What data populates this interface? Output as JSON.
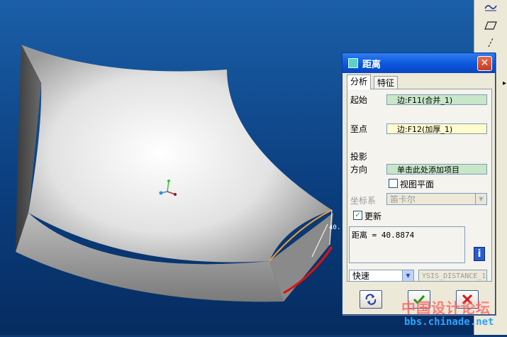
{
  "dialog": {
    "title": "距离",
    "close_symbol": "✕",
    "tabs": [
      {
        "label": "分析"
      },
      {
        "label": "特征"
      }
    ],
    "from_label": "起始",
    "from_value": "边:F11(合并_1)",
    "to_label": "至点",
    "to_value": "边:F12(加厚_1)",
    "projection_label": "投影",
    "direction_label": "方向",
    "direction_value": "单击此处添加项目",
    "view_plane_label": "视图平面",
    "csys_label": "坐标系",
    "csys_value": "笛卡尔",
    "update_label": "更新",
    "update_checked": "✓",
    "result_text": "距离 = 40.8874",
    "info_symbol": "i",
    "mode_value": "快速",
    "name_value": "YSIS_DISTANCE_1"
  },
  "viewport": {
    "dimension_label": "40."
  },
  "watermark": {
    "line1": "中国设计论坛",
    "line2": "bbs.chinade.net"
  },
  "icons": [
    "analysis-graph-icon",
    "plane-icon",
    "datum-axis-icon",
    "repeat-icon",
    "ok-check-icon",
    "cancel-x-icon"
  ],
  "colors": {
    "title_blue": "#0b56dd",
    "field_green": "#c8e6c8",
    "field_yellow": "#fffbcc",
    "edge_red": "#e01010",
    "edge_orange": "#f0a040"
  }
}
